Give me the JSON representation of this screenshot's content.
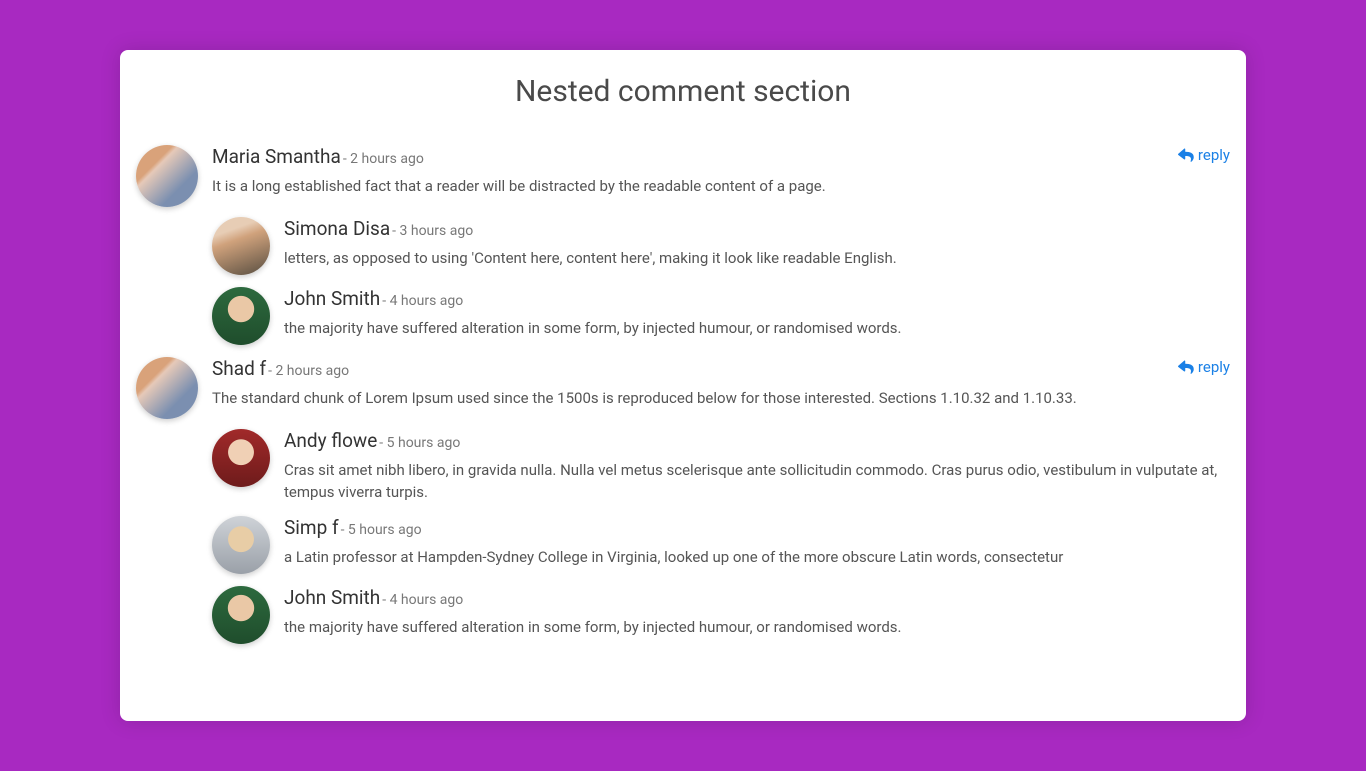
{
  "title": "Nested comment section",
  "replyLabel": "reply",
  "threads": [
    {
      "name": "Maria Smantha",
      "time": "2 hours ago",
      "text": "It is a long established fact that a reader will be distracted by the readable content of a page.",
      "avatarClass": "av-1",
      "hasReply": true,
      "replies": [
        {
          "name": "Simona Disa",
          "time": "3 hours ago",
          "text": "letters, as opposed to using 'Content here, content here', making it look like readable English.",
          "avatarClass": "av-2"
        },
        {
          "name": "John Smith",
          "time": "4 hours ago",
          "text": "the majority have suffered alteration in some form, by injected humour, or randomised words.",
          "avatarClass": "av-3"
        }
      ]
    },
    {
      "name": "Shad f",
      "time": "2 hours ago",
      "text": "The standard chunk of Lorem Ipsum used since the 1500s is reproduced below for those interested. Sections 1.10.32 and 1.10.33.",
      "avatarClass": "av-4",
      "hasReply": true,
      "replies": [
        {
          "name": "Andy flowe",
          "time": "5 hours ago",
          "text": "Cras sit amet nibh libero, in gravida nulla. Nulla vel metus scelerisque ante sollicitudin commodo. Cras purus odio, vestibulum in vulputate at, tempus viverra turpis.",
          "avatarClass": "av-5"
        },
        {
          "name": "Simp f",
          "time": "5 hours ago",
          "text": "a Latin professor at Hampden-Sydney College in Virginia, looked up one of the more obscure Latin words, consectetur",
          "avatarClass": "av-6"
        },
        {
          "name": "John Smith",
          "time": "4 hours ago",
          "text": "the majority have suffered alteration in some form, by injected humour, or randomised words.",
          "avatarClass": "av-7"
        }
      ]
    }
  ]
}
